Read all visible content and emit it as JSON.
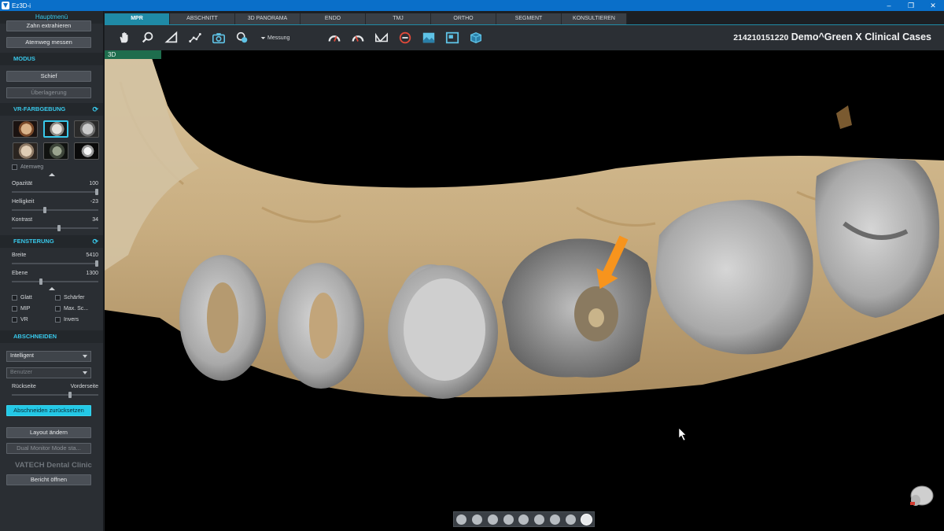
{
  "window": {
    "title": "Ez3D-i",
    "minimize": "‒",
    "maximize": "❐",
    "close": "✕"
  },
  "sidebar": {
    "menu_title": "Hauptmenü",
    "btn_extract": "Zahn extrahieren",
    "btn_airway": "Atemweg messen",
    "modus": {
      "title": "MODUS",
      "btn_oblique": "Schief",
      "btn_overlay": "Überlagerung"
    },
    "vr": {
      "title": "VR-FARBGEBUNG",
      "presets": [
        "preset-skin",
        "preset-bone",
        "preset-gray",
        "preset-soft",
        "preset-dark",
        "preset-xray"
      ],
      "airway_label": "Atemweg",
      "opacity": {
        "label": "Opazität",
        "value": "100",
        "level": 1.0
      },
      "brightness": {
        "label": "Helligkeit",
        "value": "-23",
        "level": 0.38
      },
      "contrast": {
        "label": "Kontrast",
        "value": "34",
        "level": 0.55
      }
    },
    "windowing": {
      "title": "FENSTERUNG",
      "width": {
        "label": "Breite",
        "value": "5410",
        "level": 1.0
      },
      "level": {
        "label": "Ebene",
        "value": "1300",
        "level": 0.33
      },
      "checks": [
        "Glatt",
        "Schärfer",
        "MIP",
        "Max. Sc...",
        "VR",
        "Invers"
      ]
    },
    "clipping": {
      "title": "ABSCHNEIDEN",
      "mode": "Intelligent",
      "user": "Benutzer",
      "back": "Rückseite",
      "front": "Vorderseite",
      "slider_level": 0.68,
      "reset": "Abschneiden zurücksetzen"
    },
    "btn_layout": "Layout ändern",
    "btn_dual": "Dual Monitor Mode sta...",
    "brand": "VATECH Dental Clinic",
    "btn_report": "Bericht öffnen"
  },
  "tabs": [
    "MPR",
    "ABSCHNITT",
    "3D PANORAMA",
    "ENDO",
    "TMJ",
    "ORTHO",
    "SEGMENT",
    "KONSULTIEREN"
  ],
  "toolbar": {
    "tools": [
      "hand-icon",
      "zoom-icon",
      "angle-icon",
      "polyline-icon",
      "camera-icon",
      "video-camera-icon"
    ],
    "measure_label": "Messung",
    "view_tools": [
      "gauge-icon",
      "gauge-alt-icon",
      "nerve-icon",
      "no-entry-icon",
      "image-icon",
      "layout-icon",
      "cube-icon"
    ],
    "case_id": "214210151220",
    "case_name": "Demo^Green X Clinical Cases"
  },
  "viewport": {
    "label": "3D",
    "orientation_icons": [
      "face-front",
      "face-right",
      "face-left",
      "face-top",
      "face-bottom",
      "face-back",
      "face-side",
      "face-iso",
      "face-reset"
    ]
  },
  "colors": {
    "accent": "#38c8ea",
    "tab_active": "#1f8aa6",
    "arrow": "#f7941d",
    "view_label": "#1e6d4d"
  }
}
